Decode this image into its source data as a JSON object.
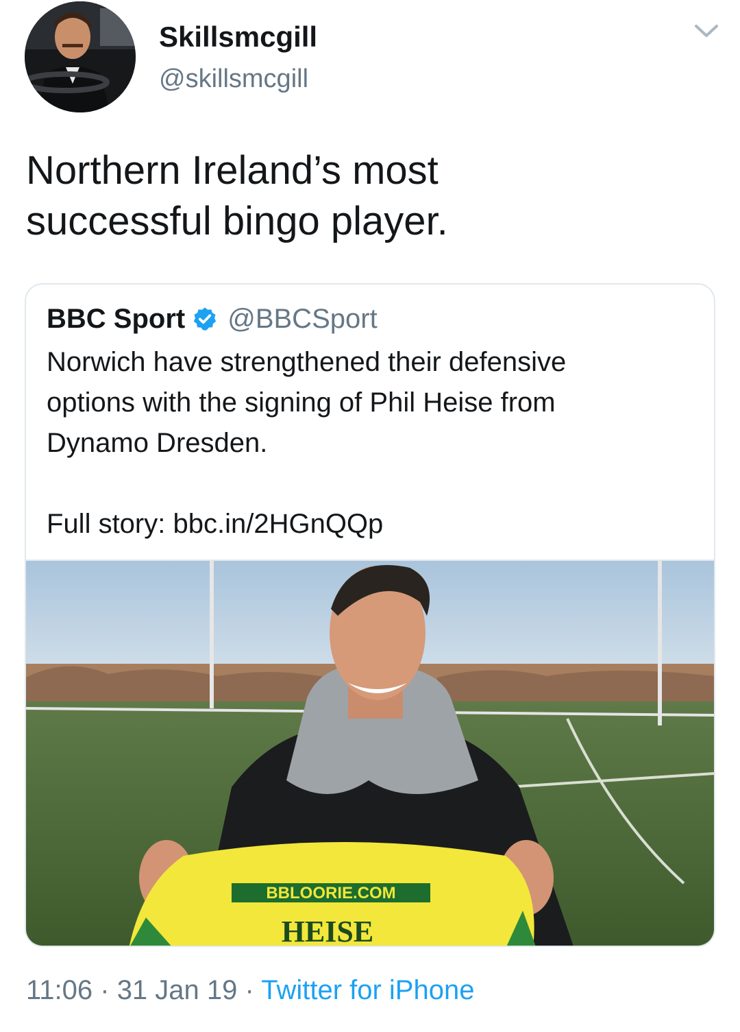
{
  "author": {
    "display_name": "Skillsmcgill",
    "handle": "@skillsmcgill"
  },
  "tweet": {
    "text_line1": "Northern Ireland’s most",
    "text_line2": "successful bingo player."
  },
  "quoted_tweet": {
    "display_name": "BBC Sport",
    "verified": true,
    "handle": "@BBCSport",
    "text_line1": "Norwich have strengthened their defensive",
    "text_line2": "options with the signing of Phil Heise from",
    "text_line3": "Dynamo Dresden.",
    "text_line4": "Full story: bbc.in/2HGnQQp",
    "image": {
      "shirt_sponsor": "BBLOORIE.COM",
      "shirt_name": "HEISE"
    }
  },
  "meta": {
    "time": "11:06",
    "separator": " · ",
    "date": "31 Jan 19",
    "source": "Twitter for iPhone"
  },
  "colors": {
    "text": "#14171a",
    "secondary": "#657786",
    "link": "#1da1f2",
    "border": "#e1e8ed",
    "verified": "#1da1f2"
  },
  "icons": [
    "chevron-down-icon",
    "verified-badge-icon"
  ]
}
